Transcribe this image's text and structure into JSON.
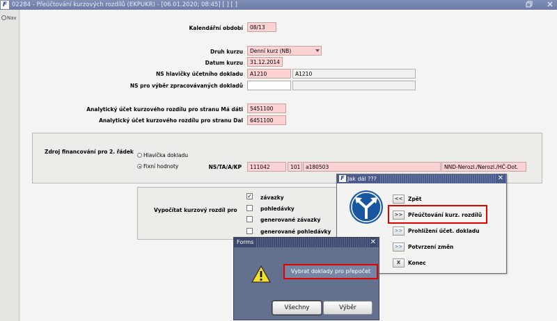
{
  "window": {
    "title": "02284 - Přeúčtování kurzových rozdílů (EKPUKR) - [06.01.2020; 08:45]  [ ]  [ ]",
    "logo": "F",
    "restore_icon": "restore-icon",
    "close_icon": "close-icon"
  },
  "nav": {
    "label": "Nav"
  },
  "form": {
    "kalendarni_obdobi": {
      "label": "Kalendářní období",
      "value": "08/13"
    },
    "druh_kurzu": {
      "label": "Druh kurzu",
      "value": "Denní kurz (NB)"
    },
    "datum_kurzu": {
      "label": "Datum kurzu",
      "value": "31.12.2014"
    },
    "ns_hlavicky": {
      "label": "NS hlavičky účetního dokladu",
      "value": "A1210",
      "desc": "A1210"
    },
    "ns_vyber": {
      "label": "NS pro výběr zpracovávaných dokladů",
      "value": "",
      "desc": ""
    },
    "ucet_ma_dati": {
      "label": "Analytický účet kurzového rozdílu pro stranu Má dáti",
      "value": "5451100"
    },
    "ucet_dal": {
      "label": "Analytický účet kurzového rozdílu pro stranu Dal",
      "value": "6451100"
    }
  },
  "zdroj": {
    "label": "Zdroj financování pro 2. řádek",
    "option1": "Hlavička dokladu",
    "option2": "Fixní hodnoty",
    "nstaakp_label": "NS/TA/A/KP",
    "ns": "111042",
    "ta": "101",
    "a": "a180503",
    "kp": "NND-Nerozl./Nerozl./HČ-Dot."
  },
  "vypocitat": {
    "label": "Vypočítat kurzový rozdíl pro",
    "check_mark": "✓",
    "items": [
      {
        "label": "závazky",
        "checked": true
      },
      {
        "label": "pohledávky",
        "checked": false
      },
      {
        "label": "generované závazky",
        "checked": false
      },
      {
        "label": "generované pohledávky",
        "checked": false
      }
    ]
  },
  "jak_dal": {
    "title": "Jak dál ???",
    "logo": "F",
    "close": "✕",
    "icon": "fork-arrows-icon",
    "options": [
      {
        "btn": "<<",
        "label": "Zpět",
        "dim": false
      },
      {
        "btn": ">>",
        "label": "Přeúčtování kurz. rozdílů",
        "dim": false
      },
      {
        "btn": ">>",
        "label": "Prohlížení účet. dokladu",
        "dim": true
      },
      {
        "btn": ">>",
        "label": "Potvrzení změn",
        "dim": true
      },
      {
        "btn": "X",
        "label": "Konec",
        "dim": false
      }
    ]
  },
  "forms_dialog": {
    "title": "Forms",
    "close": "✕",
    "icon": "warning-icon",
    "message": "Vybrat doklady pro přepočet",
    "btn_all": "Všechny",
    "btn_select": "Výběr"
  },
  "colors": {
    "required_field": "#fcd2d2",
    "highlight": "#e00000",
    "titlebar": "#7f8fb6",
    "forms_bg": "#63718f"
  }
}
